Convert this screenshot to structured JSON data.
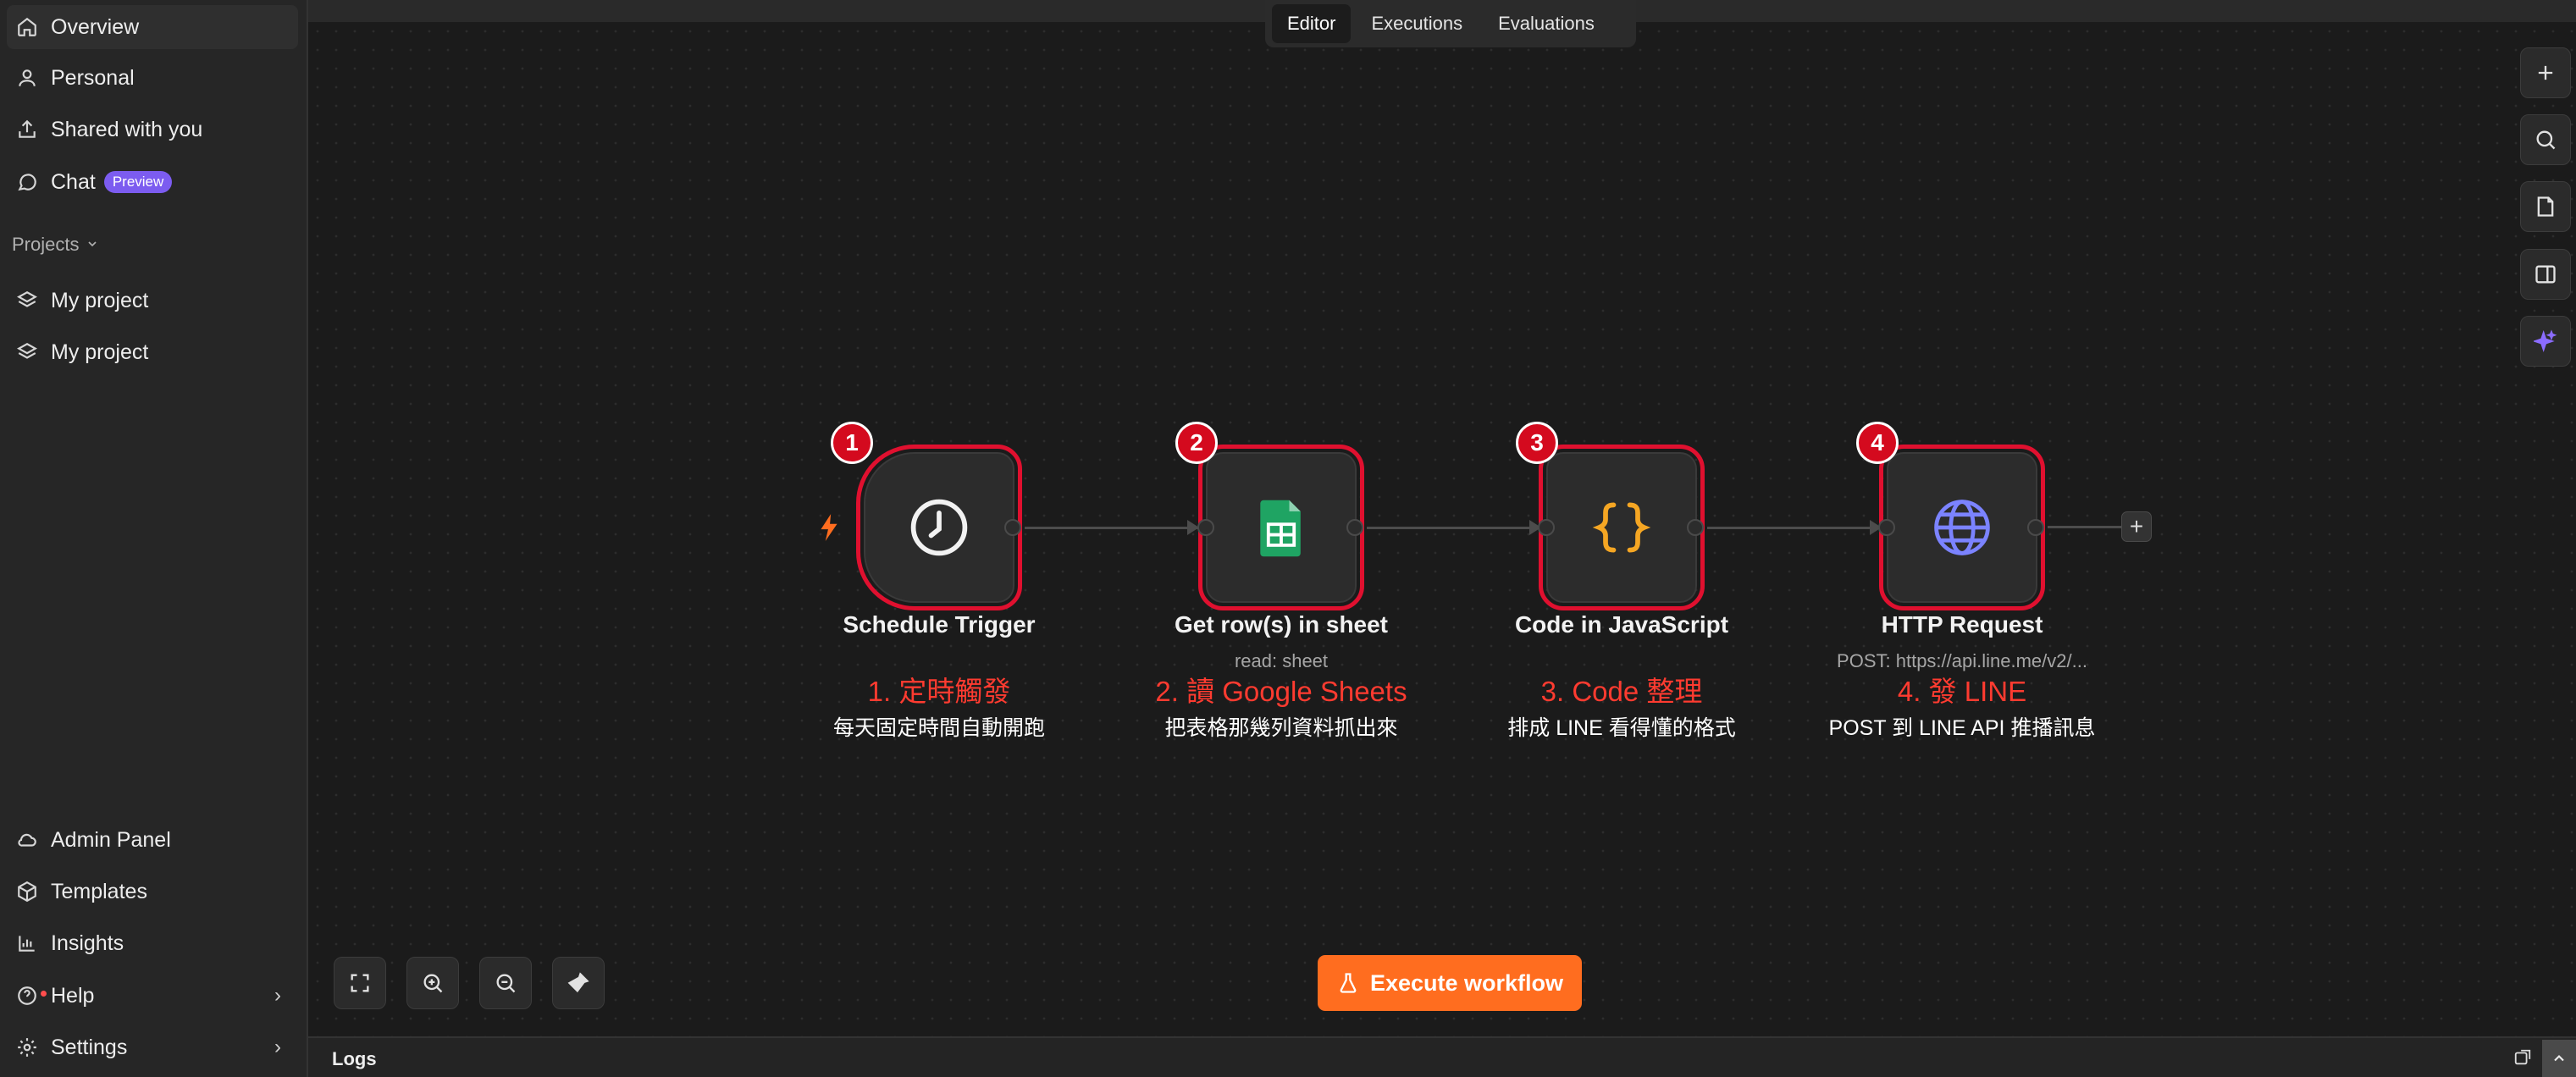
{
  "sidebar": {
    "nav": [
      {
        "label": "Overview",
        "icon": "home-icon"
      },
      {
        "label": "Personal",
        "icon": "user-icon"
      },
      {
        "label": "Shared with you",
        "icon": "share-icon"
      },
      {
        "label": "Chat",
        "icon": "chat-icon",
        "badge": "Preview"
      }
    ],
    "projects_header": "Projects",
    "projects": [
      {
        "label": "My project",
        "icon": "layers-icon"
      },
      {
        "label": "My project",
        "icon": "layers-icon"
      }
    ],
    "bottom": [
      {
        "label": "Admin Panel",
        "icon": "cloud-icon"
      },
      {
        "label": "Templates",
        "icon": "package-icon"
      },
      {
        "label": "Insights",
        "icon": "bar-chart-icon"
      },
      {
        "label": "Help",
        "icon": "help-icon"
      },
      {
        "label": "Settings",
        "icon": "gear-icon"
      }
    ]
  },
  "tabs": [
    "Editor",
    "Executions",
    "Evaluations"
  ],
  "active_tab": "Editor",
  "workflow": {
    "nodes": [
      {
        "step": "1",
        "title": "Schedule Trigger",
        "subtitle": "",
        "icon": "clock-icon",
        "annotation_title": "1. 定時觸發",
        "annotation_desc": "每天固定時間自動開跑"
      },
      {
        "step": "2",
        "title": "Get row(s) in sheet",
        "subtitle": "read: sheet",
        "icon": "google-sheets-icon",
        "annotation_title": "2. 讀 Google Sheets",
        "annotation_desc": "把表格那幾列資料抓出來"
      },
      {
        "step": "3",
        "title": "Code in JavaScript",
        "subtitle": "",
        "icon": "code-braces-icon",
        "annotation_title": "3. Code 整理",
        "annotation_desc": "排成 LINE 看得懂的格式"
      },
      {
        "step": "4",
        "title": "HTTP Request",
        "subtitle": "POST: https://api.line.me/v2/...",
        "icon": "globe-icon",
        "annotation_title": "4. 發 LINE",
        "annotation_desc": "POST 到 LINE API 推播訊息"
      }
    ],
    "add_node_label": "+"
  },
  "execute_button": "Execute workflow",
  "logs_label": "Logs",
  "colors": {
    "accent": "#ff6d1f",
    "highlight": "#e0102f",
    "annotation": "#ff3b30",
    "badge": "#7c5cf0"
  }
}
